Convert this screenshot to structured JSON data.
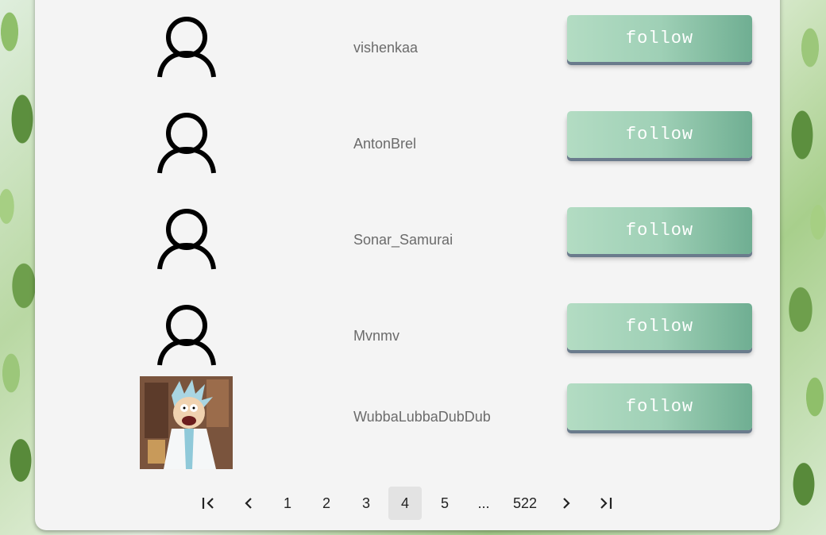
{
  "users": [
    {
      "name": "vishenkaa",
      "avatar": "default-user-icon"
    },
    {
      "name": "AntonBrel",
      "avatar": "default-user-icon"
    },
    {
      "name": "Sonar_Samurai",
      "avatar": "default-user-icon"
    },
    {
      "name": "Mvnmv",
      "avatar": "default-user-icon"
    },
    {
      "name": "WubbaLubbaDubDub",
      "avatar": "rick-photo"
    }
  ],
  "follow_label": "follow",
  "pagination": {
    "first_icon": "first-page-icon",
    "prev_icon": "chevron-left-icon",
    "pages": [
      "1",
      "2",
      "3",
      "4",
      "5"
    ],
    "current": "4",
    "ellipsis": "...",
    "last_page": "522",
    "next_icon": "chevron-right-icon",
    "last_icon": "last-page-icon"
  },
  "colors": {
    "button_gradient_start": "#b3dcc3",
    "button_gradient_end": "#6fae92",
    "button_shadow": "#6a7b8c",
    "panel_bg": "#f4f4f4",
    "active_page_bg": "#e3e3e3"
  }
}
